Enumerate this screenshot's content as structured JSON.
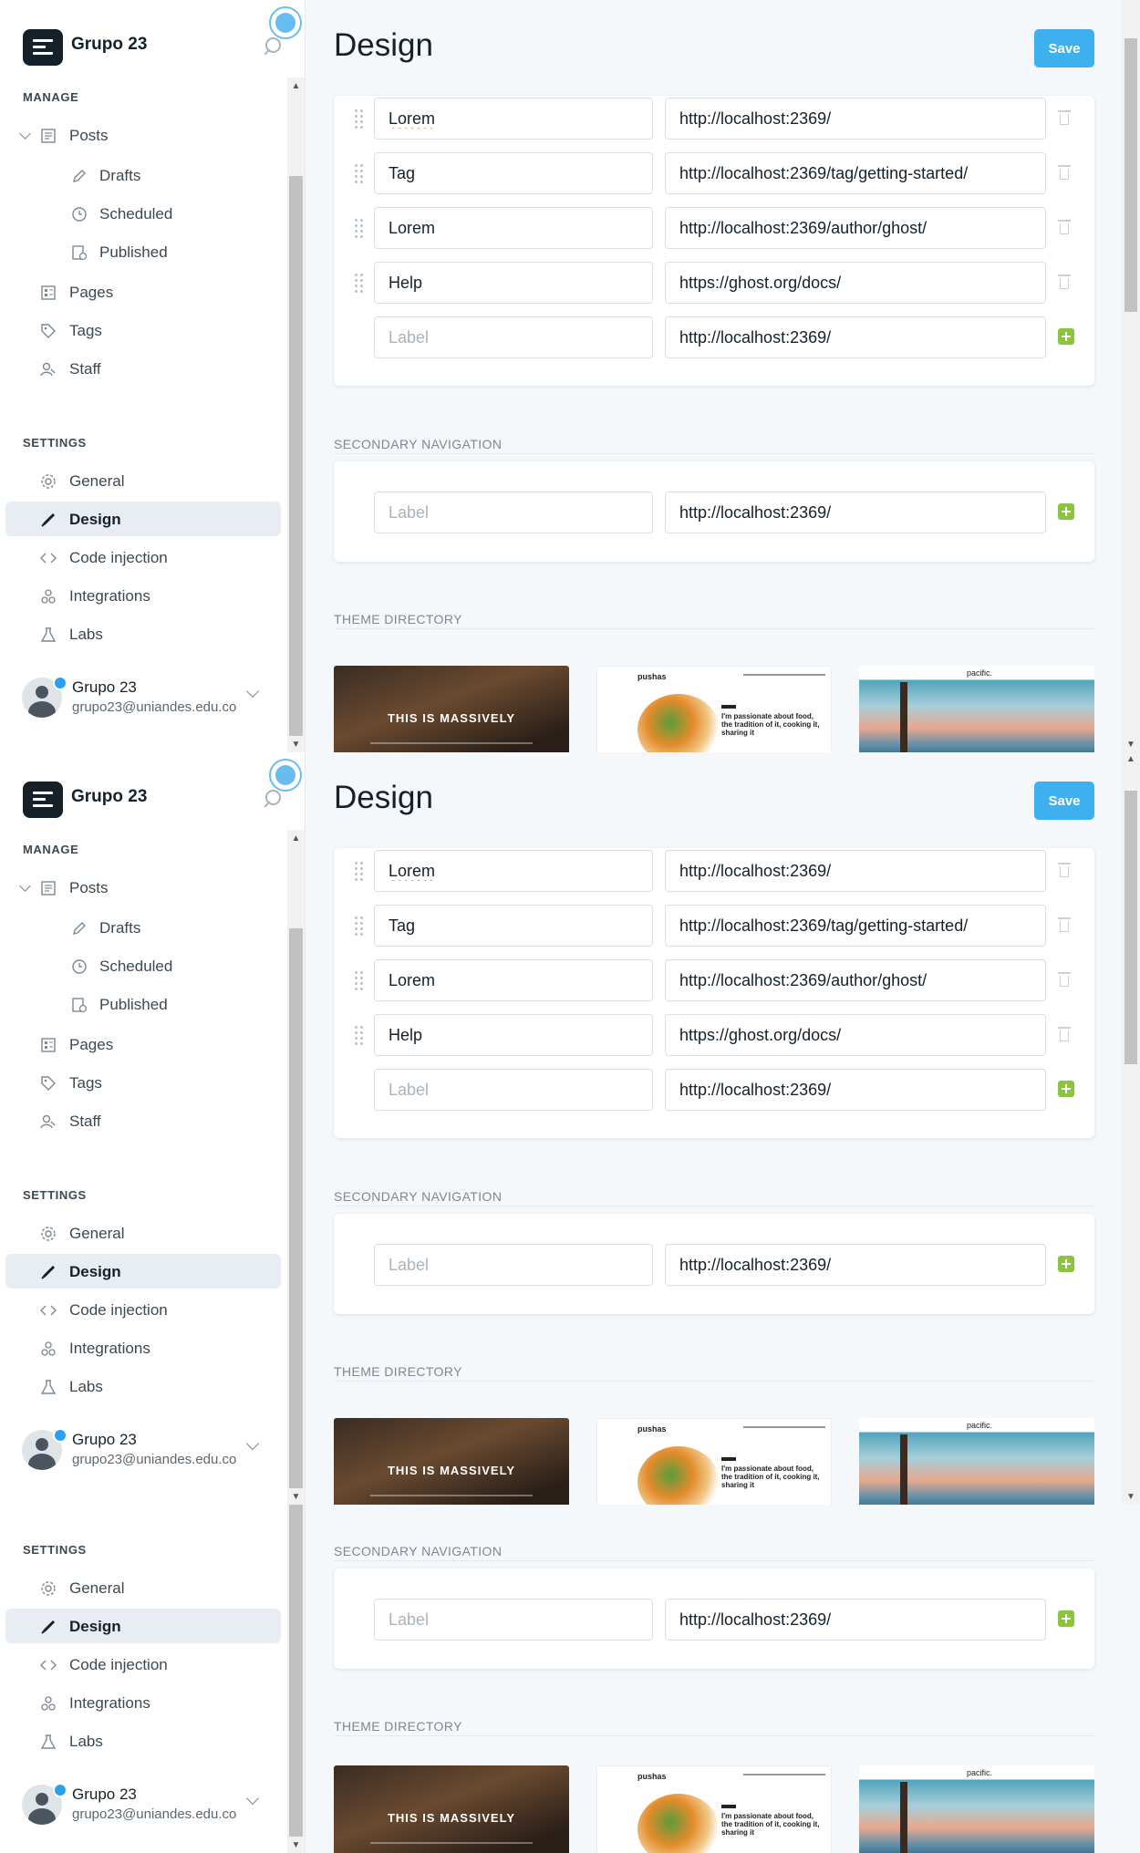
{
  "sidebar": {
    "site_title": "Grupo 23",
    "manage_heading": "MANAGE",
    "settings_heading": "SETTINGS",
    "posts": "Posts",
    "drafts": "Drafts",
    "scheduled": "Scheduled",
    "published": "Published",
    "pages": "Pages",
    "tags": "Tags",
    "staff": "Staff",
    "general": "General",
    "design": "Design",
    "code_injection": "Code injection",
    "integrations": "Integrations",
    "labs": "Labs",
    "user_name": "Grupo 23",
    "user_email": "grupo23@uniandes.edu.co"
  },
  "main": {
    "title": "Design",
    "save_label": "Save",
    "primary_nav": [
      {
        "label": "Lorem",
        "url": "http://localhost:2369/"
      },
      {
        "label": "Tag",
        "url": "http://localhost:2369/tag/getting-started/"
      },
      {
        "label": "Lorem",
        "url": "http://localhost:2369/author/ghost/"
      },
      {
        "label": "Help",
        "url": "https://ghost.org/docs/"
      }
    ],
    "new_item": {
      "label_placeholder": "Label",
      "url": "http://localhost:2369/"
    },
    "secondary_heading": "SECONDARY NAVIGATION",
    "secondary_new": {
      "label_placeholder": "Label",
      "url": "http://localhost:2369/"
    },
    "theme_heading": "THEME DIRECTORY",
    "themes": {
      "casper_text": "THIS IS MASSIVELY",
      "edition_logo": "pushas",
      "edition_headline": "I'm passionate about food, the tradition of it, cooking it, sharing it",
      "pacific_logo": "pacific."
    }
  },
  "colors": {
    "accent": "#3eb0ef",
    "add_green": "#8bc53f",
    "active_bg": "#e7edf3"
  }
}
